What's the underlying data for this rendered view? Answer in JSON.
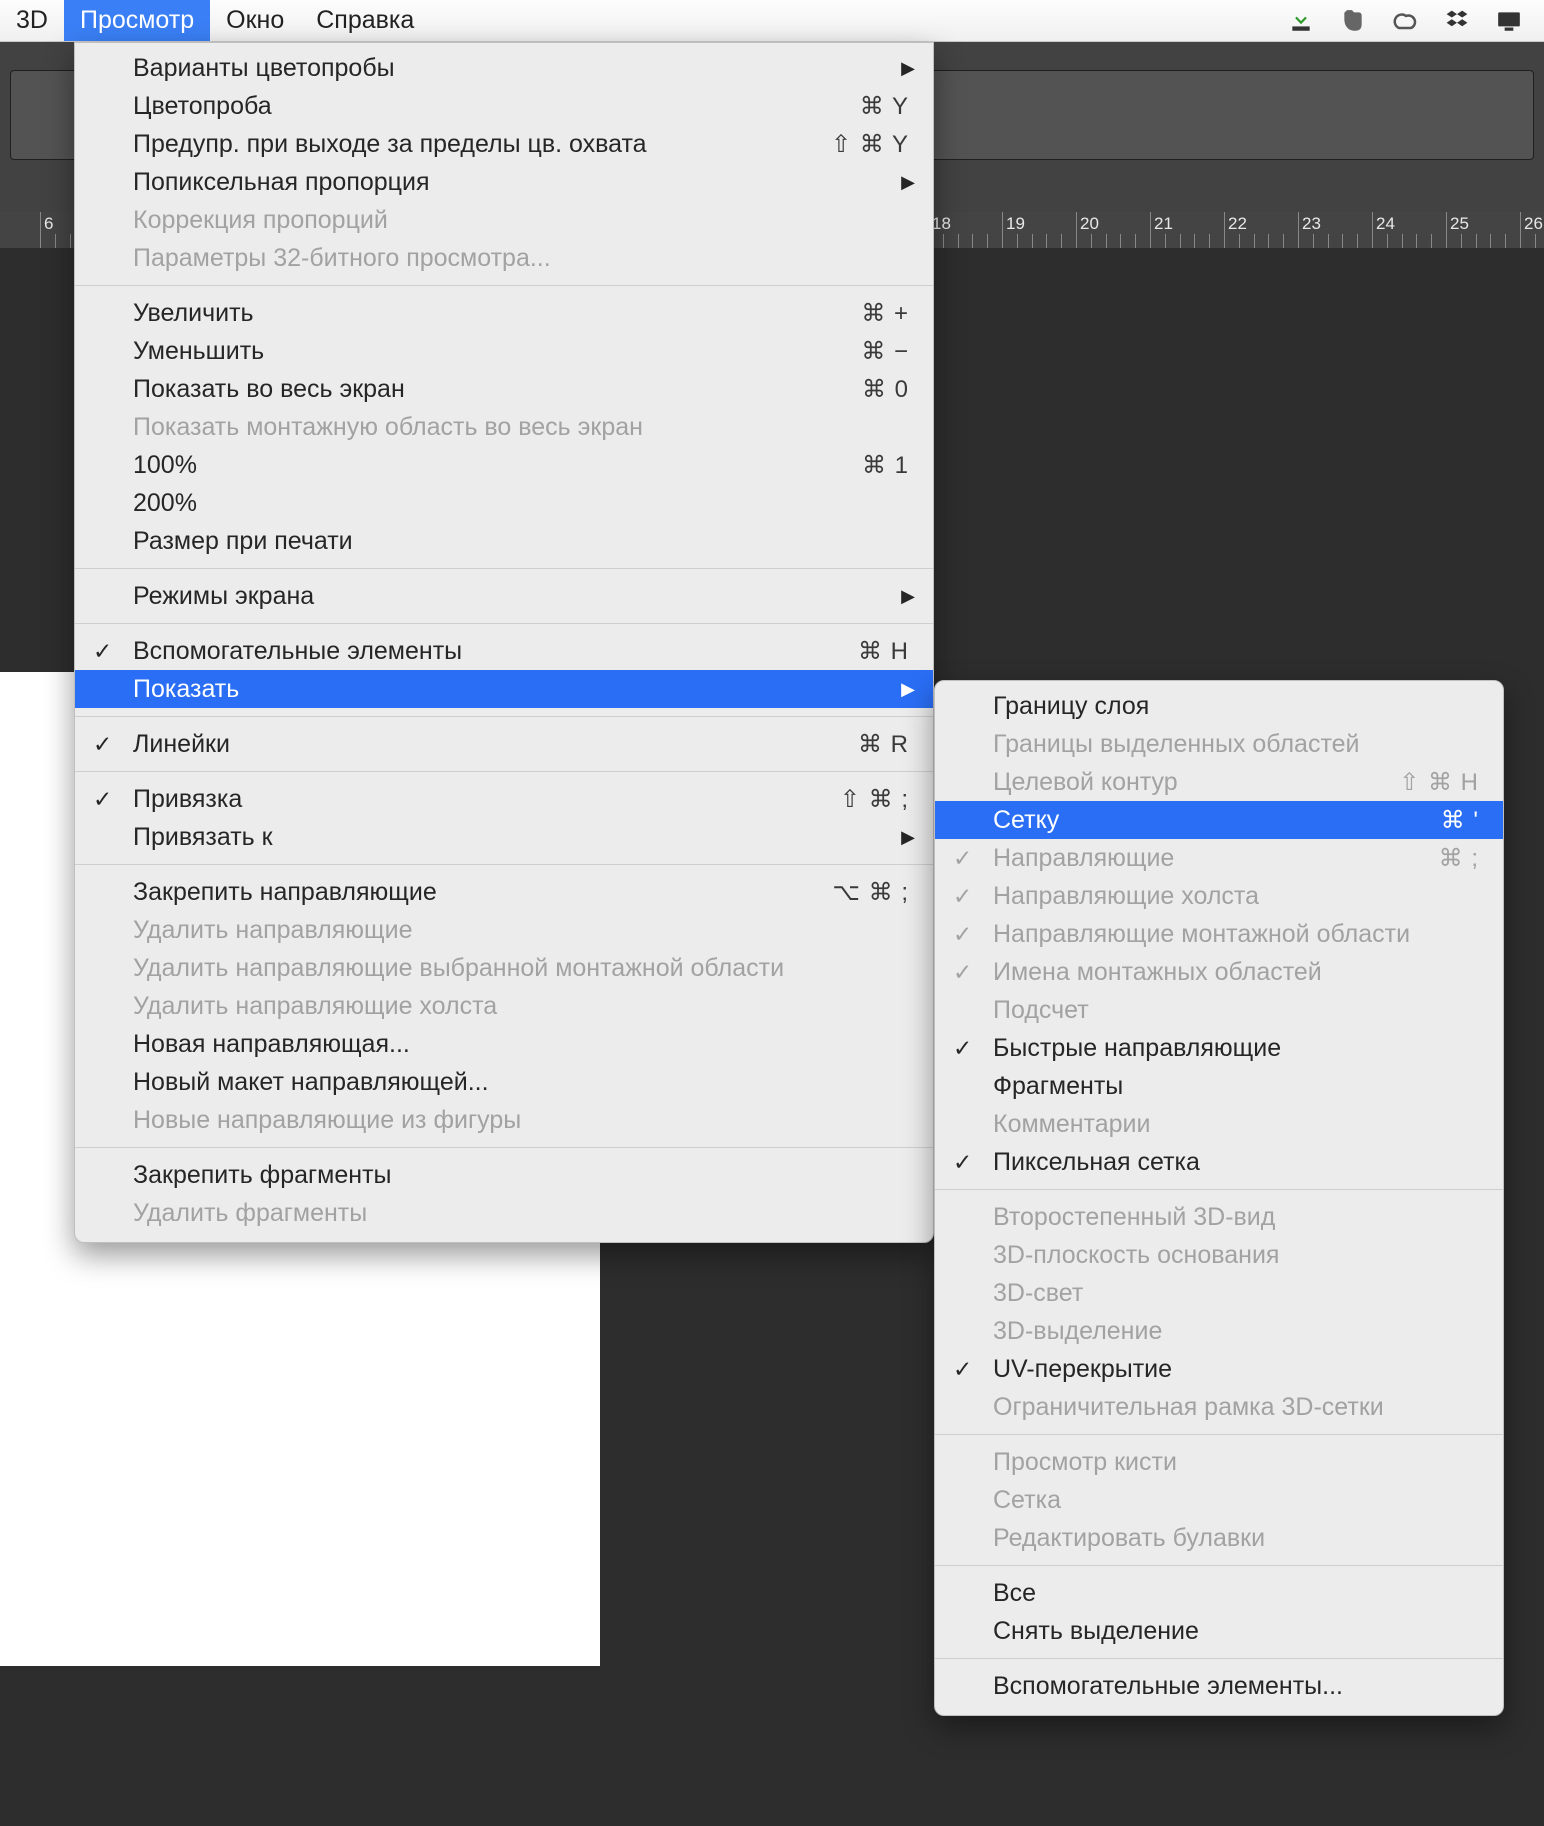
{
  "menubar": {
    "items": [
      {
        "label": "3D",
        "active": false
      },
      {
        "label": "Просмотр",
        "active": true
      },
      {
        "label": "Окно",
        "active": false
      },
      {
        "label": "Справка",
        "active": false
      }
    ],
    "tray_icons": [
      "download-icon",
      "evernote-icon",
      "creative-cloud-icon",
      "dropbox-icon",
      "monitor-icon"
    ]
  },
  "ruler_start": 6,
  "ruler_end": 26,
  "main_menu": [
    {
      "type": "item",
      "label": "Варианты цветопробы",
      "submenu": true
    },
    {
      "type": "item",
      "label": "Цветопроба",
      "shortcut": "⌘ Y"
    },
    {
      "type": "item",
      "label": "Предупр. при выходе за пределы цв. охвата",
      "shortcut": "⇧ ⌘ Y"
    },
    {
      "type": "item",
      "label": "Попиксельная пропорция",
      "submenu": true
    },
    {
      "type": "item",
      "label": "Коррекция пропорций",
      "disabled": true
    },
    {
      "type": "item",
      "label": "Параметры 32-битного просмотра...",
      "disabled": true
    },
    {
      "type": "sep"
    },
    {
      "type": "item",
      "label": "Увеличить",
      "shortcut": "⌘ +"
    },
    {
      "type": "item",
      "label": "Уменьшить",
      "shortcut": "⌘ −"
    },
    {
      "type": "item",
      "label": "Показать во весь экран",
      "shortcut": "⌘ 0"
    },
    {
      "type": "item",
      "label": "Показать монтажную область во весь экран",
      "disabled": true
    },
    {
      "type": "item",
      "label": "100%",
      "shortcut": "⌘ 1"
    },
    {
      "type": "item",
      "label": "200%"
    },
    {
      "type": "item",
      "label": "Размер при печати"
    },
    {
      "type": "sep"
    },
    {
      "type": "item",
      "label": "Режимы экрана",
      "submenu": true
    },
    {
      "type": "sep"
    },
    {
      "type": "item",
      "label": "Вспомогательные элементы",
      "checked": true,
      "shortcut": "⌘ H"
    },
    {
      "type": "item",
      "label": "Показать",
      "submenu": true,
      "highlight": true
    },
    {
      "type": "sep"
    },
    {
      "type": "item",
      "label": "Линейки",
      "checked": true,
      "shortcut": "⌘ R"
    },
    {
      "type": "sep"
    },
    {
      "type": "item",
      "label": "Привязка",
      "checked": true,
      "shortcut": "⇧ ⌘ ;"
    },
    {
      "type": "item",
      "label": "Привязать к",
      "submenu": true
    },
    {
      "type": "sep"
    },
    {
      "type": "item",
      "label": "Закрепить направляющие",
      "shortcut": "⌥ ⌘ ;"
    },
    {
      "type": "item",
      "label": "Удалить направляющие",
      "disabled": true
    },
    {
      "type": "item",
      "label": "Удалить направляющие выбранной монтажной области",
      "disabled": true
    },
    {
      "type": "item",
      "label": "Удалить направляющие холста",
      "disabled": true
    },
    {
      "type": "item",
      "label": "Новая направляющая..."
    },
    {
      "type": "item",
      "label": "Новый макет направляющей..."
    },
    {
      "type": "item",
      "label": "Новые направляющие из фигуры",
      "disabled": true
    },
    {
      "type": "sep"
    },
    {
      "type": "item",
      "label": "Закрепить фрагменты"
    },
    {
      "type": "item",
      "label": "Удалить фрагменты",
      "disabled": true
    }
  ],
  "sub_menu": [
    {
      "type": "item",
      "label": "Границу слоя"
    },
    {
      "type": "item",
      "label": "Границы выделенных областей",
      "disabled": true
    },
    {
      "type": "item",
      "label": "Целевой контур",
      "disabled": true,
      "shortcut": "⇧ ⌘ H"
    },
    {
      "type": "item",
      "label": "Сетку",
      "highlight": true,
      "shortcut": "⌘ '"
    },
    {
      "type": "item",
      "label": "Направляющие",
      "checked": true,
      "disabled": true,
      "shortcut": "⌘ ;"
    },
    {
      "type": "item",
      "label": "Направляющие холста",
      "checked": true,
      "disabled": true
    },
    {
      "type": "item",
      "label": "Направляющие монтажной области",
      "checked": true,
      "disabled": true
    },
    {
      "type": "item",
      "label": "Имена монтажных областей",
      "checked": true,
      "disabled": true
    },
    {
      "type": "item",
      "label": "Подсчет",
      "disabled": true
    },
    {
      "type": "item",
      "label": "Быстрые направляющие",
      "checked": true
    },
    {
      "type": "item",
      "label": "Фрагменты"
    },
    {
      "type": "item",
      "label": "Комментарии",
      "disabled": true
    },
    {
      "type": "item",
      "label": "Пиксельная сетка",
      "checked": true
    },
    {
      "type": "sep"
    },
    {
      "type": "item",
      "label": "Второстепенный 3D-вид",
      "disabled": true
    },
    {
      "type": "item",
      "label": "3D-плоскость основания",
      "disabled": true
    },
    {
      "type": "item",
      "label": "3D-свет",
      "disabled": true
    },
    {
      "type": "item",
      "label": "3D-выделение",
      "disabled": true
    },
    {
      "type": "item",
      "label": "UV-перекрытие",
      "checked": true
    },
    {
      "type": "item",
      "label": "Ограничительная рамка 3D-сетки",
      "disabled": true
    },
    {
      "type": "sep"
    },
    {
      "type": "item",
      "label": "Просмотр кисти",
      "disabled": true
    },
    {
      "type": "item",
      "label": "Сетка",
      "disabled": true
    },
    {
      "type": "item",
      "label": "Редактировать булавки",
      "disabled": true
    },
    {
      "type": "sep"
    },
    {
      "type": "item",
      "label": "Все"
    },
    {
      "type": "item",
      "label": "Снять выделение"
    },
    {
      "type": "sep"
    },
    {
      "type": "item",
      "label": "Вспомогательные элементы..."
    }
  ]
}
